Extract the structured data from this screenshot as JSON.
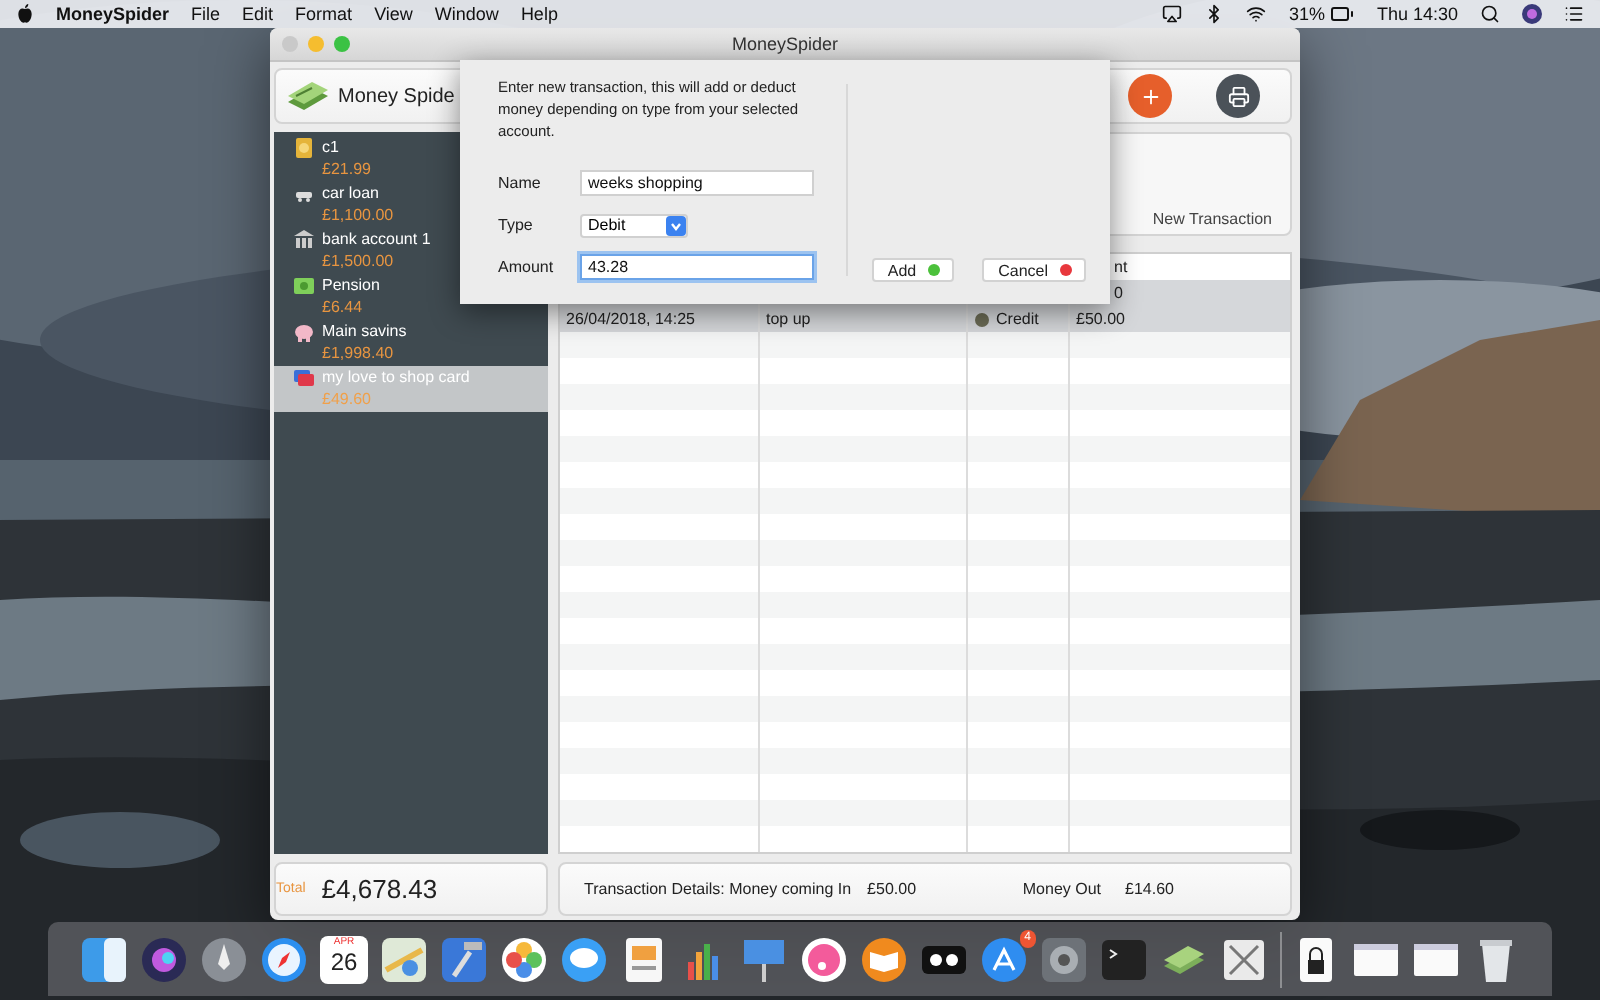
{
  "menu_bar": {
    "app": "MoneySpider",
    "menus": [
      "File",
      "Edit",
      "Format",
      "View",
      "Window",
      "Help"
    ],
    "battery": "31%",
    "clock": "Thu 14:30"
  },
  "window": {
    "title": "MoneySpider"
  },
  "header": {
    "app_name": "Money Spide"
  },
  "accounts": [
    {
      "name": "c1",
      "balance": "£21.99",
      "selected": false,
      "kind": "coin"
    },
    {
      "name": "car loan",
      "balance": "£1,100.00",
      "selected": false,
      "kind": "car"
    },
    {
      "name": "bank account 1",
      "balance": "£1,500.00",
      "selected": false,
      "kind": "bank"
    },
    {
      "name": "Pension",
      "balance": "£6.44",
      "selected": false,
      "kind": "cash"
    },
    {
      "name": "Main savins",
      "balance": "£1,998.40",
      "selected": false,
      "kind": "piggy"
    },
    {
      "name": "my love to shop card",
      "balance": "£49.60",
      "selected": true,
      "kind": "card"
    }
  ],
  "transaction_panel": {
    "button": "New Transaction"
  },
  "table": {
    "amount_header": "nt",
    "rows": [
      {
        "amount": "0",
        "selected": true
      },
      {
        "date": "26/04/2018, 14:25",
        "description": "top up",
        "type": "Credit",
        "amount": "£50.00",
        "selected": true
      }
    ]
  },
  "footer": {
    "total_label": "Total",
    "total": "£4,678.43",
    "details_label": "Transaction Details: Money coming In",
    "money_in": "£50.00",
    "money_out_label": "Money Out",
    "money_out": "£14.60"
  },
  "sheet": {
    "message": "Enter new transaction, this will add or deduct money depending on type from your selected account.",
    "fields": [
      {
        "label": "Name",
        "kind": "text",
        "value": "weeks shopping",
        "focused": false
      },
      {
        "label": "Type",
        "kind": "select",
        "value": "Debit",
        "focused": false
      },
      {
        "label": "Amount",
        "kind": "text",
        "value": "43.28",
        "focused": true
      }
    ],
    "buttons": [
      {
        "label": "Add",
        "color": "#4cc13b"
      },
      {
        "label": "Cancel",
        "color": "#e8383d"
      }
    ]
  },
  "dock": {
    "calendar_month": "APR",
    "calendar_day": "26",
    "badge": "4"
  }
}
